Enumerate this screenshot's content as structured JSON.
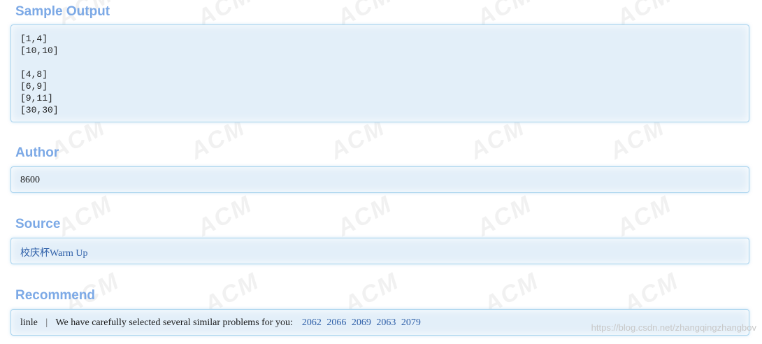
{
  "watermark": {
    "text": "ACM"
  },
  "sample_output": {
    "title": "Sample Output",
    "lines": [
      "[1,4]",
      "[10,10]",
      "",
      "[4,8]",
      "[6,9]",
      "[9,11]",
      "[30,30]"
    ]
  },
  "author": {
    "title": "Author",
    "value": "8600"
  },
  "source": {
    "title": "Source",
    "link_text": "校庆杯Warm Up"
  },
  "recommend": {
    "title": "Recommend",
    "user": "linle",
    "separator": "|",
    "message": "We have carefully selected several similar problems for you:",
    "problems": [
      "2062",
      "2066",
      "2069",
      "2063",
      "2079"
    ]
  },
  "blog_watermark": "https://blog.csdn.net/zhangqingzhangbov"
}
